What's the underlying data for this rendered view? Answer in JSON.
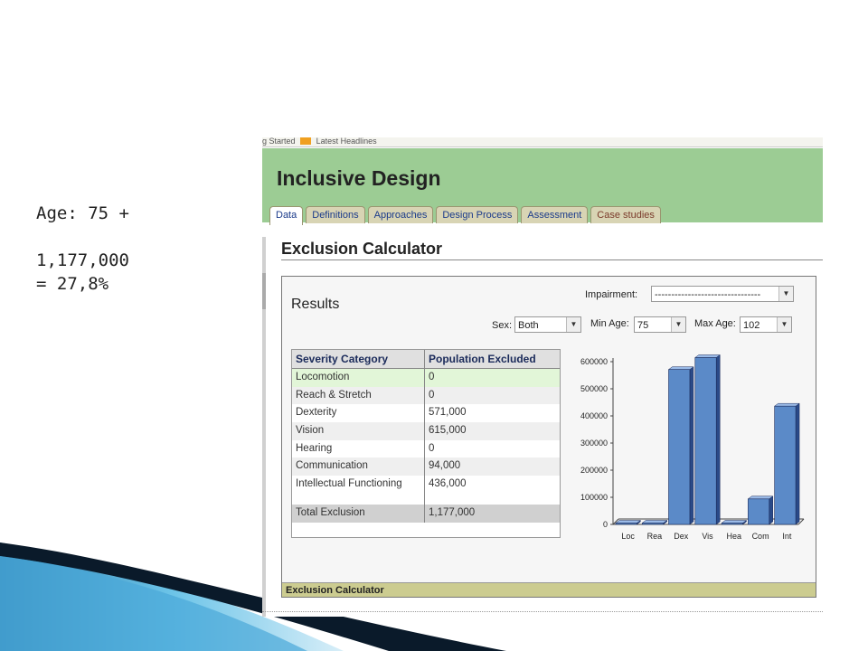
{
  "slide": {
    "line1": "Age: 75 +",
    "line2": "1,177,000",
    "line3": "= 27,8%"
  },
  "browser": {
    "topstrip_left": "g Started",
    "topstrip_right": "Latest Headlines"
  },
  "site": {
    "title": "Inclusive Design",
    "tabs": [
      {
        "label": "Data"
      },
      {
        "label": "Definitions"
      },
      {
        "label": "Approaches"
      },
      {
        "label": "Design Process"
      },
      {
        "label": "Assessment"
      },
      {
        "label": "Case studies"
      }
    ]
  },
  "page": {
    "title": "Exclusion Calculator"
  },
  "panel": {
    "heading": "Results",
    "impairment_label": "Impairment:",
    "impairment_value": "--------------------------------",
    "sex_label": "Sex:",
    "sex_value": "Both",
    "min_age_label": "Min Age:",
    "min_age_value": "75",
    "max_age_label": "Max Age:",
    "max_age_value": "102",
    "footer": "Exclusion Calculator"
  },
  "table": {
    "headers": [
      "Severity Category",
      "Population Excluded"
    ],
    "rows": [
      {
        "category": "Locomotion",
        "value": "0"
      },
      {
        "category": "Reach & Stretch",
        "value": "0"
      },
      {
        "category": "Dexterity",
        "value": "571,000"
      },
      {
        "category": "Vision",
        "value": "615,000"
      },
      {
        "category": "Hearing",
        "value": "0"
      },
      {
        "category": "Communication",
        "value": "94,000"
      },
      {
        "category": "Intellectual Functioning",
        "value": "436,000"
      }
    ],
    "total_label": "Total Exclusion",
    "total_value": "1,177,000"
  },
  "chart_data": {
    "type": "bar",
    "categories": [
      "Loc",
      "Rea",
      "Dex",
      "Vis",
      "Hea",
      "Com",
      "Int"
    ],
    "values": [
      0,
      0,
      571000,
      615000,
      0,
      94000,
      436000
    ],
    "yticks": [
      "600000",
      "500000",
      "400000",
      "300000",
      "200000",
      "100000",
      "0"
    ],
    "ylim": [
      0,
      600000
    ],
    "bar_color": "#5b8ac8",
    "grid": false,
    "legend": "none"
  }
}
